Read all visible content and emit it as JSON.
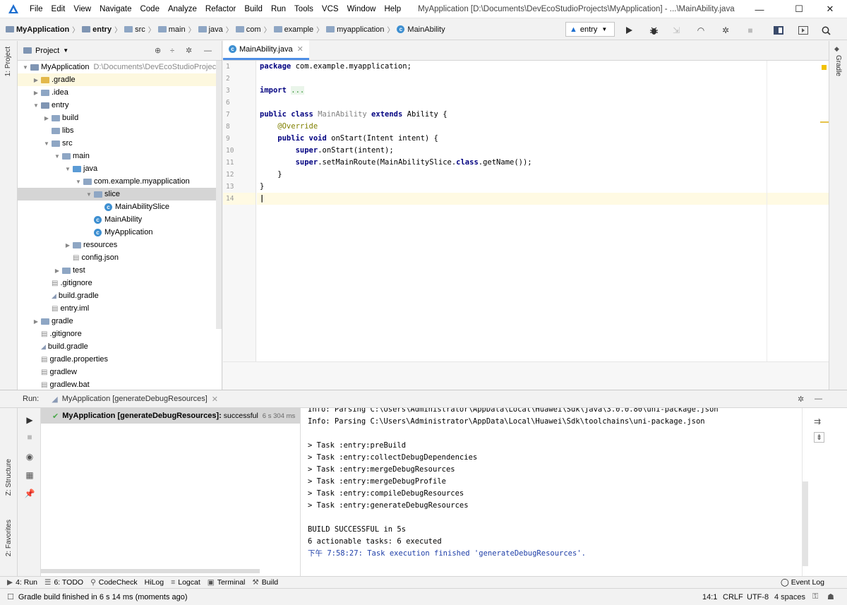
{
  "menu": [
    "File",
    "Edit",
    "View",
    "Navigate",
    "Code",
    "Analyze",
    "Refactor",
    "Build",
    "Run",
    "Tools",
    "VCS",
    "Window",
    "Help"
  ],
  "window_title": "MyApplication [D:\\Documents\\DevEcoStudioProjects\\MyApplication] - ...\\MainAbility.java",
  "window_controls": {
    "minimize": "—",
    "maximize": "☐",
    "close": "✕"
  },
  "breadcrumbs": [
    "MyApplication",
    "entry",
    "src",
    "main",
    "java",
    "com",
    "example",
    "myapplication",
    "MainAbility"
  ],
  "run_config": "entry",
  "left_strip": {
    "project": "1: Project",
    "structure": "Z: Structure",
    "favorites": "2: Favorites"
  },
  "right_strip": {
    "gradle": "Gradle"
  },
  "project_panel": {
    "title": "Project",
    "tree": [
      {
        "label": "MyApplication",
        "path": "D:\\Documents\\DevEcoStudioProject",
        "indent": 0,
        "arrow": "▼",
        "icon": "module"
      },
      {
        "label": ".gradle",
        "indent": 1,
        "arrow": "▶",
        "icon": "folder-yellow"
      },
      {
        "label": ".idea",
        "indent": 1,
        "arrow": "▶",
        "icon": "folder"
      },
      {
        "label": "entry",
        "indent": 1,
        "arrow": "▼",
        "icon": "module"
      },
      {
        "label": "build",
        "indent": 2,
        "arrow": "▶",
        "icon": "folder"
      },
      {
        "label": "libs",
        "indent": 2,
        "arrow": "",
        "icon": "folder"
      },
      {
        "label": "src",
        "indent": 2,
        "arrow": "▼",
        "icon": "folder"
      },
      {
        "label": "main",
        "indent": 3,
        "arrow": "▼",
        "icon": "folder"
      },
      {
        "label": "java",
        "indent": 4,
        "arrow": "▼",
        "icon": "folder-blue"
      },
      {
        "label": "com.example.myapplication",
        "indent": 5,
        "arrow": "▼",
        "icon": "folder"
      },
      {
        "label": "slice",
        "indent": 6,
        "arrow": "▼",
        "icon": "folder"
      },
      {
        "label": "MainAbilitySlice",
        "indent": 7,
        "arrow": "",
        "icon": "class"
      },
      {
        "label": "MainAbility",
        "indent": 6,
        "arrow": "",
        "icon": "class"
      },
      {
        "label": "MyApplication",
        "indent": 6,
        "arrow": "",
        "icon": "class"
      },
      {
        "label": "resources",
        "indent": 4,
        "arrow": "▶",
        "icon": "folder"
      },
      {
        "label": "config.json",
        "indent": 4,
        "arrow": "",
        "icon": "file"
      },
      {
        "label": "test",
        "indent": 3,
        "arrow": "▶",
        "icon": "folder"
      },
      {
        "label": ".gitignore",
        "indent": 2,
        "arrow": "",
        "icon": "file"
      },
      {
        "label": "build.gradle",
        "indent": 2,
        "arrow": "",
        "icon": "gradle"
      },
      {
        "label": "entry.iml",
        "indent": 2,
        "arrow": "",
        "icon": "file"
      },
      {
        "label": "gradle",
        "indent": 1,
        "arrow": "▶",
        "icon": "folder"
      },
      {
        "label": ".gitignore",
        "indent": 1,
        "arrow": "",
        "icon": "file"
      },
      {
        "label": "build.gradle",
        "indent": 1,
        "arrow": "",
        "icon": "gradle"
      },
      {
        "label": "gradle.properties",
        "indent": 1,
        "arrow": "",
        "icon": "file"
      },
      {
        "label": "gradlew",
        "indent": 1,
        "arrow": "",
        "icon": "file"
      },
      {
        "label": "gradlew.bat",
        "indent": 1,
        "arrow": "",
        "icon": "file"
      }
    ]
  },
  "editor": {
    "tab": "MainAbility.java",
    "line_numbers": [
      "1",
      "2",
      "3",
      "6",
      "7",
      "8",
      "9",
      "10",
      "11",
      "12",
      "13",
      "14"
    ],
    "code": [
      [
        {
          "t": "package ",
          "c": "kw"
        },
        {
          "t": "com.example.myapplication;",
          "c": ""
        }
      ],
      [],
      [
        {
          "t": "import ",
          "c": "kw"
        },
        {
          "t": "...",
          "c": "fold"
        }
      ],
      [],
      [
        {
          "t": "public class ",
          "c": "kw"
        },
        {
          "t": "MainAbility ",
          "c": "gray"
        },
        {
          "t": "extends ",
          "c": "kw"
        },
        {
          "t": "Ability {",
          "c": ""
        }
      ],
      [
        {
          "t": "    @Override",
          "c": "ann"
        }
      ],
      [
        {
          "t": "    public void ",
          "c": "kw"
        },
        {
          "t": "onStart(Intent intent) {",
          "c": ""
        }
      ],
      [
        {
          "t": "        super",
          "c": "kw"
        },
        {
          "t": ".onStart(intent);",
          "c": ""
        }
      ],
      [
        {
          "t": "        super",
          "c": "kw"
        },
        {
          "t": ".setMainRoute(MainAbilitySlice.",
          "c": ""
        },
        {
          "t": "class",
          "c": "kw"
        },
        {
          "t": ".getName());",
          "c": ""
        }
      ],
      [
        {
          "t": "    }",
          "c": ""
        }
      ],
      [
        {
          "t": "}",
          "c": ""
        }
      ],
      []
    ]
  },
  "run_panel": {
    "label": "Run:",
    "config": "MyApplication [generateDebugResources]",
    "tree_item": "MyApplication [generateDebugResources]:",
    "tree_status": "successful",
    "tree_time": "6 s 304 ms",
    "console": [
      {
        "t": "Info: Parsing C:\\Users\\Administrator\\AppData\\Local\\Huawei\\Sdk\\java\\3.0.0.80\\uni-package.json",
        "c": ""
      },
      {
        "t": "Info: Parsing C:\\Users\\Administrator\\AppData\\Local\\Huawei\\Sdk\\toolchains\\uni-package.json",
        "c": ""
      },
      {
        "t": "",
        "c": ""
      },
      {
        "t": "> Task :entry:preBuild",
        "c": ""
      },
      {
        "t": "> Task :entry:collectDebugDependencies",
        "c": ""
      },
      {
        "t": "> Task :entry:mergeDebugResources",
        "c": ""
      },
      {
        "t": "> Task :entry:mergeDebugProfile",
        "c": ""
      },
      {
        "t": "> Task :entry:compileDebugResources",
        "c": ""
      },
      {
        "t": "> Task :entry:generateDebugResources",
        "c": ""
      },
      {
        "t": "",
        "c": ""
      },
      {
        "t": "BUILD SUCCESSFUL in 5s",
        "c": ""
      },
      {
        "t": "6 actionable tasks: 6 executed",
        "c": ""
      },
      {
        "t": "下午 7:58:27: Task execution finished 'generateDebugResources'.",
        "c": "blue"
      }
    ]
  },
  "bottom_tabs": [
    "4: Run",
    "6: TODO",
    "CodeCheck",
    "HiLog",
    "Logcat",
    "Terminal",
    "Build"
  ],
  "event_log": "Event Log",
  "status": {
    "message": "Gradle build finished in 6 s 14 ms (moments ago)",
    "position": "14:1",
    "line_sep": "CRLF",
    "encoding": "UTF-8",
    "indent": "4 spaces"
  },
  "colors": {
    "accent": "#4d8ee6",
    "keyword": "#000080",
    "annotation": "#808000",
    "success": "#4aa84a",
    "link": "#1f3fa8"
  }
}
